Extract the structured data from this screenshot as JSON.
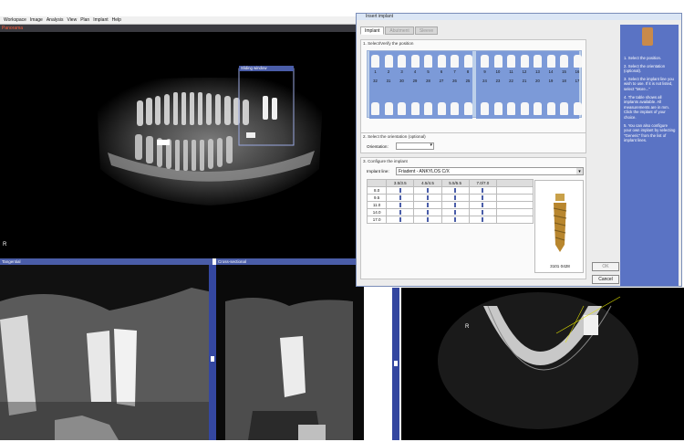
{
  "app": {
    "menu": [
      "Workspace",
      "Image",
      "Analysis",
      "View",
      "Plan",
      "Implant",
      "Help"
    ],
    "panorama_label": "Panorama",
    "sliding_window_label": "Sliding window",
    "orientation_marker": "R",
    "tangential_label": "Tangential",
    "cross_sectional_label": "Cross-sectional",
    "axial_orientation_marker": "R"
  },
  "dialog": {
    "title": "Insert implant",
    "tabs": [
      "Implant",
      "Abutment",
      "Sleeve"
    ],
    "step1_label": "1. Select/Verify the position",
    "upper_numbers": [
      "1",
      "2",
      "3",
      "4",
      "5",
      "6",
      "7",
      "8",
      "9",
      "10",
      "11",
      "12",
      "13",
      "14",
      "15",
      "16"
    ],
    "lower_numbers": [
      "32",
      "31",
      "30",
      "29",
      "28",
      "27",
      "26",
      "25",
      "24",
      "23",
      "22",
      "21",
      "20",
      "19",
      "18",
      "17"
    ],
    "step2_label": "2. Select the orientation (optional)",
    "orientation_label": "Orientation:",
    "orientation_value": "",
    "step3_label": "3. Configure the implant",
    "implant_line_label": "Implant line:",
    "implant_line_value": "Friadent - ANKYLOS C/X",
    "diameters": [
      "3.5/3.5",
      "4.5/4.5",
      "5.5/5.5",
      "7.0/7.0"
    ],
    "lengths": [
      "8.0",
      "9.5",
      "11.0",
      "14.0",
      "17.0"
    ],
    "preview_code": "3101 0428",
    "ok_label": "OK",
    "cancel_label": "Cancel"
  },
  "help": {
    "steps": [
      "1. Select the position.",
      "2. Select the orientation (optional).",
      "3. Select the implant line you wish to use. If it is not listed, select \"More...\"",
      "4. The table shows all implants available. All measurements are in mm. Click the implant of your choice.",
      "5. You can also configure your own implant by selecting \"Generic\" from the list of implant lines."
    ]
  }
}
